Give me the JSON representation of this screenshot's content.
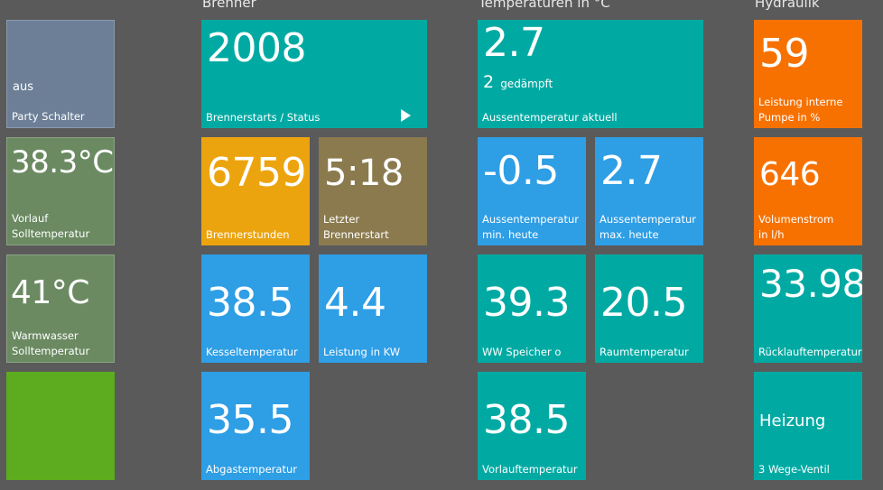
{
  "headers": {
    "brenner": "Brenner",
    "temperaturen": "Temperaturen in °C",
    "hydraulik": "Hydraulik"
  },
  "left": {
    "party": {
      "value": "aus",
      "label": "Party Schalter"
    },
    "vorlauf_soll": {
      "value": "38.3°C",
      "label": "Vorlauf\nSolltemperatur"
    },
    "warmwasser_soll": {
      "value": "41°C",
      "label": "Warmwasser\nSolltemperatur"
    }
  },
  "brenner": {
    "starts": {
      "value": "2008",
      "label": "Brennerstarts / Status"
    },
    "stunden": {
      "value": "6759",
      "label": "Brennerstunden"
    },
    "letzter_start": {
      "value": "5:18",
      "label": "Letzter\nBrennerstart"
    },
    "kessel": {
      "value": "38.5",
      "label": "Kesseltemperatur"
    },
    "leistung": {
      "value": "4.4",
      "label": "Leistung in KW"
    },
    "abgas": {
      "value": "35.5",
      "label": "Abgastemperatur"
    }
  },
  "temperaturen": {
    "aussen": {
      "value": "2.7",
      "damped_value": "2",
      "damped_label": "gedämpft",
      "label": "Aussentemperatur aktuell"
    },
    "aussen_min": {
      "value": "-0.5",
      "label": "Aussentemperatur\nmin. heute"
    },
    "aussen_max": {
      "value": "2.7",
      "label": "Aussentemperatur\nmax. heute"
    },
    "ww_speicher": {
      "value": "39.3",
      "label": "WW Speicher o"
    },
    "raum": {
      "value": "20.5",
      "label": "Raumtemperatur"
    },
    "vorlauf": {
      "value": "38.5",
      "label": "Vorlauftemperatur"
    }
  },
  "hydraulik": {
    "pumpe": {
      "value": "59",
      "label": "Leistung interne\nPumpe in %"
    },
    "volumenstrom": {
      "value": "646",
      "label": "Volumenstrom\nin l/h"
    },
    "ruecklauf": {
      "value": "33.98",
      "label": "Rücklauftemperatur"
    },
    "ventil": {
      "value": "Heizung",
      "label": "3 Wege-Ventil"
    }
  }
}
